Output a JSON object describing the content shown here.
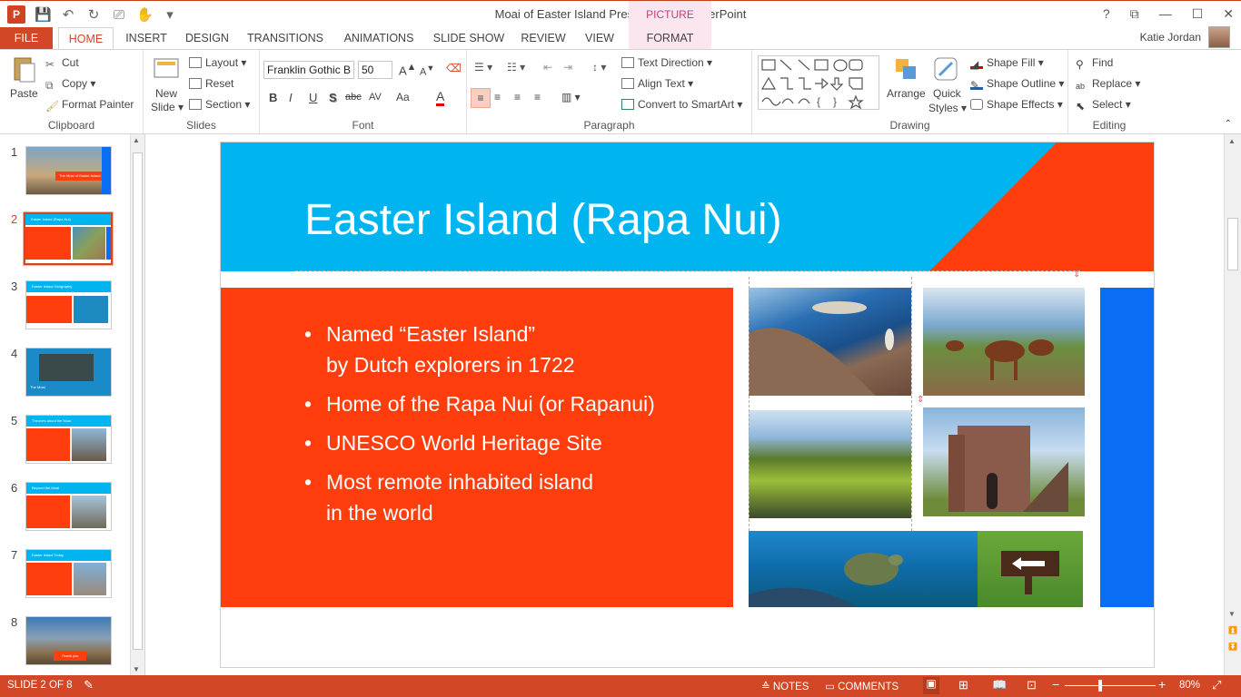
{
  "window": {
    "title": "Moai of Easter Island Presentation - PowerPoint",
    "picture_tools": "PICTURE TOOLS",
    "help": "?"
  },
  "tabs": [
    "FILE",
    "HOME",
    "INSERT",
    "DESIGN",
    "TRANSITIONS",
    "ANIMATIONS",
    "SLIDE SHOW",
    "REVIEW",
    "VIEW",
    "FORMAT"
  ],
  "user": {
    "name": "Katie Jordan"
  },
  "ribbon": {
    "clipboard": {
      "label": "Clipboard",
      "paste": "Paste",
      "cut": "Cut",
      "copy": "Copy",
      "format_painter": "Format Painter"
    },
    "slides": {
      "label": "Slides",
      "new_slide_1": "New",
      "new_slide_2": "Slide",
      "layout": "Layout",
      "reset": "Reset",
      "section": "Section"
    },
    "font": {
      "label": "Font",
      "font_name": "Franklin Gothic B",
      "font_size": "50",
      "bold": "B",
      "italic": "I",
      "underline": "U",
      "shadow": "S",
      "strike": "abc",
      "spacing": "AV",
      "case": "Aa",
      "color": "A"
    },
    "paragraph": {
      "label": "Paragraph",
      "text_direction": "Text Direction",
      "align_text": "Align Text",
      "convert_smartart": "Convert to SmartArt"
    },
    "drawing": {
      "label": "Drawing",
      "arrange": "Arrange",
      "quick_1": "Quick",
      "quick_2": "Styles",
      "shape_fill": "Shape Fill",
      "shape_outline": "Shape Outline",
      "shape_effects": "Shape Effects"
    },
    "editing": {
      "label": "Editing",
      "find": "Find",
      "replace": "Replace",
      "select": "Select"
    }
  },
  "thumbnails": [
    {
      "num": "1",
      "title": "The Moai of Easter Island"
    },
    {
      "num": "2",
      "title": "Easter Island (Rapa Nui)"
    },
    {
      "num": "3",
      "title": "Easter Island Geography"
    },
    {
      "num": "4",
      "title": "The Moai"
    },
    {
      "num": "5",
      "title": "Theories about the Moai"
    },
    {
      "num": "6",
      "title": "Beyond the Moai"
    },
    {
      "num": "7",
      "title": "Easter Island Today"
    },
    {
      "num": "8",
      "title": "Thank you"
    }
  ],
  "slide": {
    "title": "Easter Island (Rapa Nui)",
    "bullets": [
      {
        "line1": "Named “Easter Island”",
        "line2": "by Dutch explorers in 1722"
      },
      {
        "line1": "Home of the Rapa Nui (or Rapanui)",
        "line2": ""
      },
      {
        "line1": "UNESCO World Heritage Site",
        "line2": ""
      },
      {
        "line1": "Most remote inhabited island",
        "line2": "in the world"
      }
    ]
  },
  "status": {
    "slide_of": "SLIDE 2 OF 8",
    "notes": "NOTES",
    "comments": "COMMENTS",
    "zoom": "80%"
  },
  "colors": {
    "accent": "#d24726",
    "slide_red": "#ff3d0d",
    "slide_cyan": "#00b4f0",
    "slide_blue": "#0a6ef5"
  }
}
